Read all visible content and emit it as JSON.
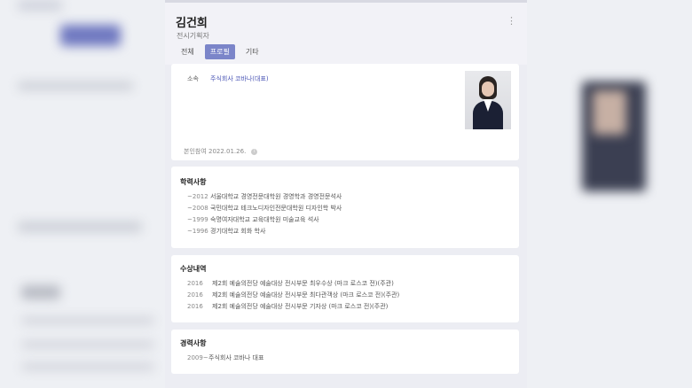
{
  "header": {
    "name": "김건희",
    "subtitle": "전시기획자",
    "more_icon": "⋮",
    "tabs": [
      {
        "label": "전체"
      },
      {
        "label": "프로필"
      },
      {
        "label": "기타"
      }
    ]
  },
  "profile": {
    "affiliation_label": "소속",
    "affiliation_value": "주식회사 코바나(대표)",
    "verified_text": "본인참여 2022.01.26.",
    "info_icon": "i"
  },
  "education": {
    "title": "학력사항",
    "items": [
      {
        "year": "~2012",
        "text": "서울대학교 경영전문대학원 경영학과 경영전문석사"
      },
      {
        "year": "~2008",
        "text": "국민대학교 테크노디자인전문대학원 디자인학 박사"
      },
      {
        "year": "~1999",
        "text": "숙명여자대학교 교육대학원 미술교육 석사"
      },
      {
        "year": "~1996",
        "text": "경기대학교 회화 학사"
      }
    ]
  },
  "awards": {
    "title": "수상내역",
    "items": [
      {
        "year": "2016",
        "text": "제2회 예술의전당 예술대상 전시부문 최우수상 (마크 로스코 전)(주관)"
      },
      {
        "year": "2016",
        "text": "제2회 예술의전당 예술대상 전시부문 최다관객상 (마크 로스코 전)(주관)"
      },
      {
        "year": "2016",
        "text": "제2회 예술의전당 예술대상 전시부문 기자상 (마크 로스코 전)(주관)"
      }
    ]
  },
  "career": {
    "title": "경력사항",
    "items": [
      {
        "year": "2009~",
        "text": "주식회사 코바나 대표"
      }
    ]
  },
  "colors": {
    "accent": "#7b85c9",
    "link": "#4a55b5"
  }
}
